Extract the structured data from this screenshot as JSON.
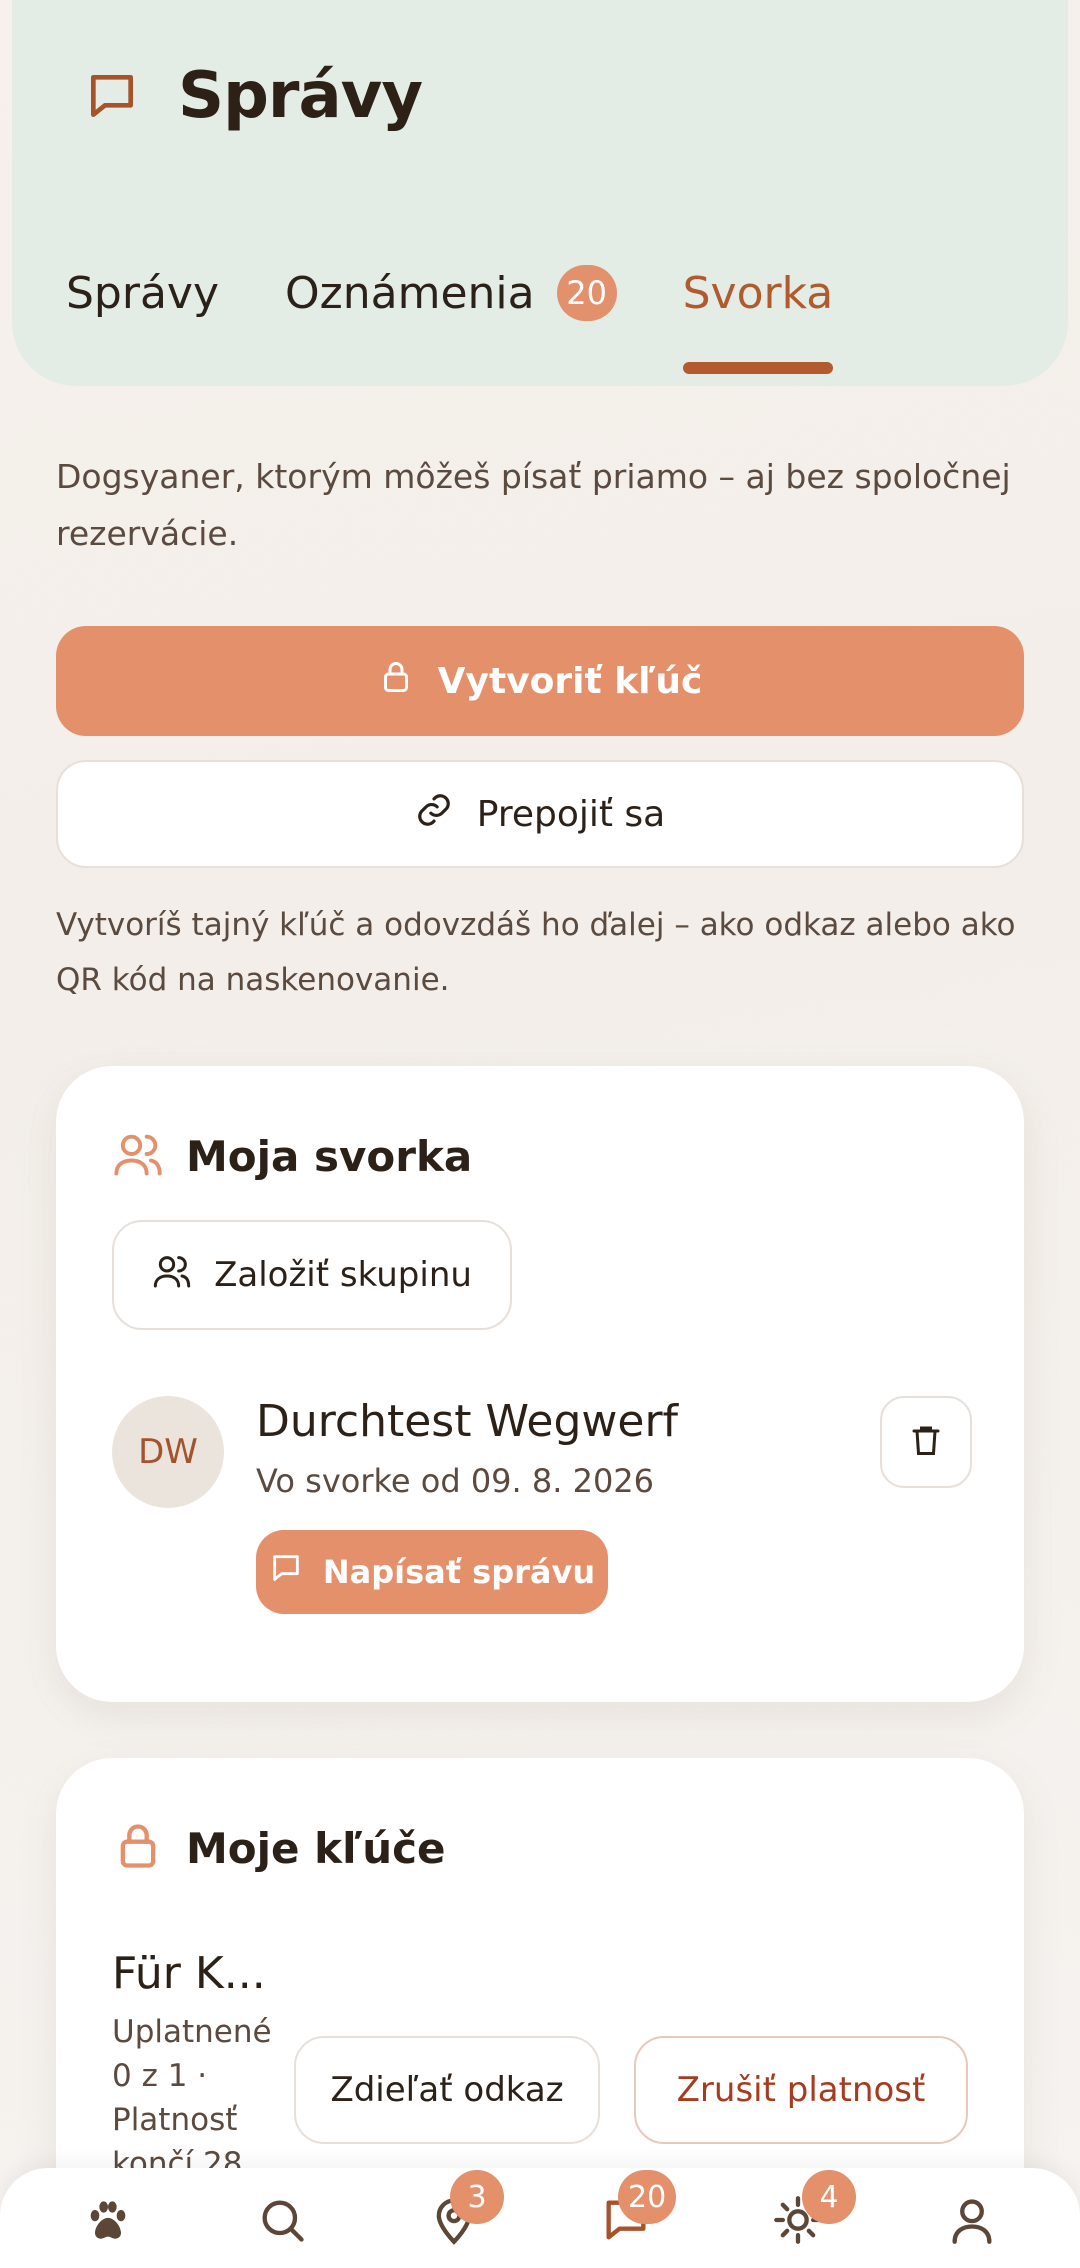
{
  "header": {
    "title": "Správy",
    "tabs": [
      {
        "label": "Správy"
      },
      {
        "label": "Oznámenia",
        "badge": "20"
      },
      {
        "label": "Svorka",
        "active": true
      }
    ]
  },
  "intro_text": "Dogsyaner, ktorým môžeš písať priamo – aj bez spoločnej rezervácie.",
  "actions": {
    "create_key_label": "Vytvoriť kľúč",
    "connect_label": "Prepojiť sa"
  },
  "hint_text": "Vytvoríš tajný kľúč a odovzdáš ho ďalej – ako odkaz alebo ako QR kód na naskenovanie.",
  "pack_card": {
    "title": "Moja svorka",
    "create_group_label": "Založiť skupinu",
    "member": {
      "initials": "DW",
      "name": "Durchtest Wegwerf",
      "since": "Vo svorke od 09. 8. 2026",
      "message_label": "Napísať správu"
    }
  },
  "keys_card": {
    "title": "Moje kľúče",
    "key": {
      "name": "Für K...",
      "meta": "Uplatnené 0 z 1 · Platnosť končí 28.",
      "share_label": "Zdieľať odkaz",
      "revoke_label": "Zrušiť platnosť"
    }
  },
  "bottom_nav": {
    "items": [
      {
        "icon": "paw-icon"
      },
      {
        "icon": "search-icon"
      },
      {
        "icon": "location-pin-icon",
        "badge": "3"
      },
      {
        "icon": "chat-icon",
        "badge": "20",
        "active": true
      },
      {
        "icon": "sun-icon",
        "badge": "4"
      },
      {
        "icon": "profile-icon"
      }
    ]
  },
  "colors": {
    "accent": "#e3906b",
    "accent_dark": "#b35a2f",
    "header_bg": "#e4ece6",
    "danger_text": "#a63c1f"
  }
}
